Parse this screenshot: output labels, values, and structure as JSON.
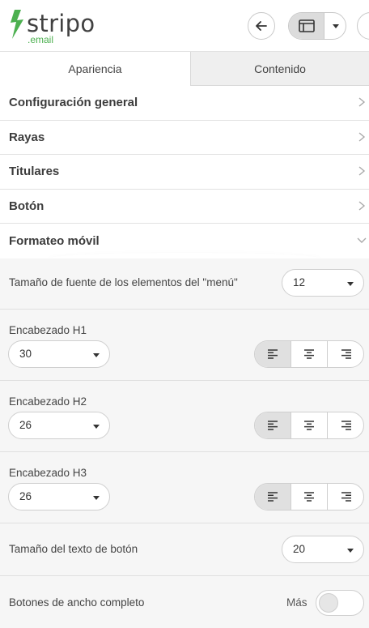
{
  "header": {
    "logo_word": "stripo",
    "logo_sub": ".email",
    "brand_color": "#4cb050",
    "back_icon": "arrow-left-icon",
    "view_icon": "layout-window-icon"
  },
  "tabs": [
    {
      "label": "Apariencia",
      "active": true
    },
    {
      "label": "Contenido",
      "active": false
    }
  ],
  "sections": [
    {
      "label": "Configuración general",
      "state": "collapsed"
    },
    {
      "label": "Rayas",
      "state": "collapsed"
    },
    {
      "label": "Titulares",
      "state": "collapsed"
    },
    {
      "label": "Botón",
      "state": "collapsed"
    },
    {
      "label": "Formateo móvil",
      "state": "expanded"
    }
  ],
  "mobile_formatting": {
    "menu_font_size": {
      "label": "Tamaño de fuente de los elementos del \"menú\"",
      "value": "12"
    },
    "h1": {
      "label": "Encabezado H1",
      "value": "30",
      "align": "left"
    },
    "h2": {
      "label": "Encabezado H2",
      "value": "26",
      "align": "left"
    },
    "h3": {
      "label": "Encabezado H3",
      "value": "26",
      "align": "left"
    },
    "button_text_size": {
      "label": "Tamaño del texto de botón",
      "value": "20"
    },
    "full_width_buttons": {
      "label": "Botones de ancho completo",
      "toggle_label": "Más",
      "on": false
    }
  }
}
